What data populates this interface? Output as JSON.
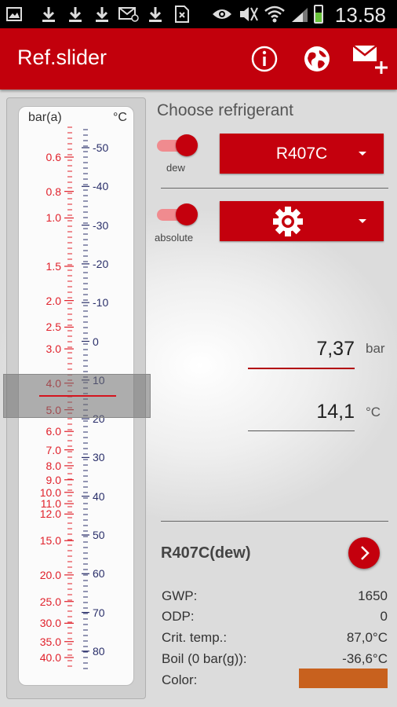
{
  "status_bar": {
    "time": "13.58",
    "icons": [
      "image-icon",
      "download-icon",
      "download-icon",
      "download-icon",
      "mail-icon",
      "download-icon",
      "sim-icon",
      "eye-icon",
      "mute-icon",
      "wifi-icon",
      "signal-icon",
      "battery-icon"
    ],
    "battery_level": 0.6,
    "battery_color": "#69c33a"
  },
  "app_bar": {
    "title": "Ref.slider",
    "color": "#c2000c",
    "actions": [
      "info-icon",
      "globe-icon",
      "mail-add-icon"
    ]
  },
  "slider": {
    "left_header": "bar(a)",
    "right_header": "°C",
    "pressure_labels": [
      "0.6",
      "0.8",
      "1.0",
      "1.5",
      "2.0",
      "2.5",
      "3.0",
      "4.0",
      "5.0",
      "6.0",
      "7.0",
      "8.0",
      "9.0",
      "10.0",
      "11.0",
      "12.0",
      "15.0",
      "20.0",
      "25.0",
      "30.0",
      "35.0",
      "40.0"
    ],
    "temperature_labels": [
      "-50",
      "-40",
      "-30",
      "-20",
      "-10",
      "0",
      "10",
      "20",
      "30",
      "40",
      "50",
      "60",
      "70",
      "80"
    ]
  },
  "controls": {
    "choose_label": "Choose refrigerant",
    "toggle1_label": "dew",
    "toggle2_label": "absolute",
    "refrigerant": "R407C",
    "settings_icon": "gear-icon"
  },
  "readout": {
    "pressure_value": "7,37",
    "pressure_unit": "bar",
    "temperature_value": "14,1",
    "temperature_unit": "°C"
  },
  "info": {
    "title": "R407C(dew)",
    "rows": [
      {
        "key": "GWP:",
        "value": "1650"
      },
      {
        "key": "ODP:",
        "value": "0"
      },
      {
        "key": "Crit. temp.:",
        "value": "87,0°C"
      },
      {
        "key": "Boil (0 bar(g)):",
        "value": "-36,6°C"
      },
      {
        "key": "Color:",
        "value": ""
      }
    ],
    "color_swatch": "#c8611e"
  },
  "colors": {
    "accent": "#c4000d",
    "pressure_scale": "#e0202a",
    "temperature_scale": "#2a2f6a"
  }
}
